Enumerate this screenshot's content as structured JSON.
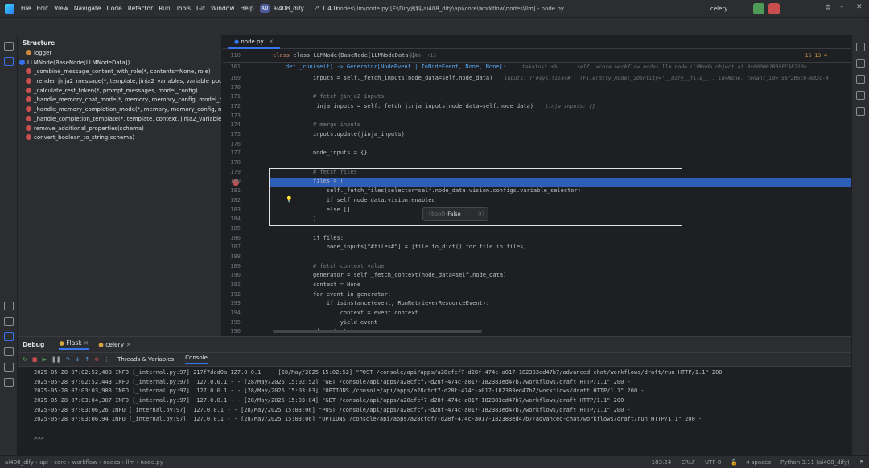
{
  "titlebar": {
    "menu": [
      "File",
      "Edit",
      "View",
      "Navigate",
      "Code",
      "Refactor",
      "Run",
      "Tools",
      "Git",
      "Window",
      "Help"
    ],
    "project_badge": "AD",
    "project_name": "ai408_dify",
    "version": "1.4.0",
    "file_path": "nodes\\llm\\node.py [F:\\Dify资料\\ai408_dify\\api\\core\\workflow\\nodes\\llm] - node.py",
    "run_config": "celery"
  },
  "structure": {
    "title": "Structure",
    "items": [
      {
        "label": "logger",
        "kind": "var",
        "indent": 1
      },
      {
        "label": "LLMNode(BaseNode[LLMNodeData])",
        "kind": "cls",
        "indent": 0
      },
      {
        "label": "_combine_message_content_with_role(*, contents=None, role)",
        "kind": "fn",
        "indent": 1
      },
      {
        "label": "_render_jinja2_message(*, template, jinja2_variables, variable_pool)",
        "kind": "fn",
        "indent": 1
      },
      {
        "label": "_calculate_rest_token(*, prompt_messages, model_config)",
        "kind": "fn",
        "indent": 1
      },
      {
        "label": "_handle_memory_chat_mode(*, memory, memory_config, model_config)",
        "kind": "fn",
        "indent": 1
      },
      {
        "label": "_handle_memory_completion_mode(*, memory, memory_config, model_config)",
        "kind": "fn",
        "indent": 1
      },
      {
        "label": "_handle_completion_template(*, template, context, jinja2_variables, variable_pool)",
        "kind": "fn",
        "indent": 1
      },
      {
        "label": "remove_additional_properties(schema)",
        "kind": "fn",
        "indent": 1
      },
      {
        "label": "convert_boolean_to_string(schema)",
        "kind": "fn",
        "indent": 1
      }
    ]
  },
  "editor": {
    "tab": "node.py",
    "class_line_no": "110",
    "class_line": "class LLMNode(BaseNode[LLMNodeData]):",
    "class_hint": "-LAN- +15",
    "run_line_no": "161",
    "run_sig": "def _run(self) -> Generator[NodeEvent | InNodeEvent, None, None]:",
    "run_author": "takatost +9",
    "run_inline": "self: <core.workflow.nodes.llm.node.LLMNode object at 0x000002B35FCAE710>",
    "inspections": "16 13 4",
    "lines": [
      {
        "n": "169",
        "t": "inputs = self._fetch_inputs(node_data=self.node_data)",
        "i": "inputs: {'#sys.files#': [File(dify_model_identity='__dify__file__', id=None, tenant_id='56f205c6-6d2c-4"
      },
      {
        "n": "170",
        "t": "",
        "i": ""
      },
      {
        "n": "171",
        "t": "# fetch jinja2 inputs",
        "i": ""
      },
      {
        "n": "172",
        "t": "jinja_inputs = self._fetch_jinja_inputs(node_data=self.node_data)",
        "i": "jinja_inputs: {}"
      },
      {
        "n": "173",
        "t": "",
        "i": ""
      },
      {
        "n": "174",
        "t": "# merge inputs",
        "i": ""
      },
      {
        "n": "175",
        "t": "inputs.update(jinja_inputs)",
        "i": ""
      },
      {
        "n": "176",
        "t": "",
        "i": ""
      },
      {
        "n": "177",
        "t": "node_inputs = {}",
        "i": ""
      },
      {
        "n": "178",
        "t": "",
        "i": ""
      },
      {
        "n": "179",
        "t": "# fetch files",
        "i": ""
      },
      {
        "n": "180",
        "t": "files = (",
        "i": ""
      },
      {
        "n": "181",
        "t": "    self._fetch_files(selector=self.node_data.vision.configs.variable_selector)",
        "i": ""
      },
      {
        "n": "182",
        "t": "    if self.node_data.vision.enabled",
        "i": ""
      },
      {
        "n": "183",
        "t": "    else []",
        "i": ""
      },
      {
        "n": "184",
        "t": ")",
        "i": ""
      },
      {
        "n": "185",
        "t": "",
        "i": ""
      },
      {
        "n": "186",
        "t": "if files:",
        "i": ""
      },
      {
        "n": "187",
        "t": "    node_inputs[\"#files#\"] = [file.to_dict() for file in files]",
        "i": ""
      },
      {
        "n": "188",
        "t": "",
        "i": ""
      },
      {
        "n": "189",
        "t": "# fetch context value",
        "i": ""
      },
      {
        "n": "190",
        "t": "generator = self._fetch_context(node_data=self.node_data)",
        "i": ""
      },
      {
        "n": "191",
        "t": "context = None",
        "i": ""
      },
      {
        "n": "192",
        "t": "for event in generator:",
        "i": ""
      },
      {
        "n": "193",
        "t": "    if isinstance(event, RunRetrieverResourceEvent):",
        "i": ""
      },
      {
        "n": "194",
        "t": "        context = event.context",
        "i": ""
      },
      {
        "n": "195",
        "t": "        yield event",
        "i": ""
      },
      {
        "n": "196",
        "t": "if context:",
        "i": ""
      }
    ],
    "popup": {
      "type": "{bool}",
      "value": "False"
    }
  },
  "debug": {
    "title": "Debug",
    "tabs": [
      "Flask",
      "celery"
    ],
    "sub_tabs": [
      "Threads & Variables",
      "Console"
    ],
    "logs": [
      "2025-05-28 07:02:52,403 INFO [_internal.py:97] 217f7dad0a 127.0.0.1 - - [28/May/2025 15:02:52] \"POST /console/api/apps/a28cfcf7-d28f-474c-a017-182383ed47b7/advanced-chat/workflows/draft/run HTTP/1.1\" 200 -",
      "2025-05-28 07:02:52,443 INFO [_internal.py:97]  127.0.0.1 - - [28/May/2025 15:02:52] \"GET /console/api/apps/a28cfcf7-d28f-474c-a017-182383ed47b7/workflows/draft HTTP/1.1\" 200 -",
      "2025-05-28 07:03:03,983 INFO [_internal.py:97]  127.0.0.1 - - [28/May/2025 15:03:03] \"OPTIONS /console/api/apps/a28cfcf7-d28f-474c-a017-182383ed47b7/workflows/draft HTTP/1.1\" 200 -",
      "2025-05-28 07:03:04,307 INFO [_internal.py:97]  127.0.0.1 - - [28/May/2025 15:03:04] \"GET /console/api/apps/a28cfcf7-d28f-474c-a017-182383ed47b7/workflows/draft HTTP/1.1\" 200 -",
      "2025-05-28 07:03:06,26 INFO [_internal.py:97]  127.0.0.1 - - [28/May/2025 15:03:06] \"POST /console/api/apps/a28cfcf7-d28f-474c-a017-182383ed47b7/workflows/draft HTTP/1.1\" 200 -",
      "2025-05-28 07:03:06,94 INFO [_internal.py:97]  127.0.0.1 - - [28/May/2025 15:03:06] \"OPTIONS /console/api/apps/a28cfcf7-d28f-474c-a017-182383ed47b7/advanced-chat/workflows/draft/run HTTP/1.1\" 200 -"
    ],
    "prompt": ">>>"
  },
  "status": {
    "breadcrumb": [
      "ai408_dify",
      "api",
      "core",
      "workflow",
      "nodes",
      "llm",
      "node.py"
    ],
    "position": "183:24",
    "line_sep": "CRLF",
    "encoding": "UTF-8",
    "indent": "4 spaces",
    "interpreter": "Python 3.11 (ai408_dify)"
  },
  "colors": {
    "accent": "#3574f0",
    "breakpoint": "#c94f4f",
    "highlight": "#2d5fb8",
    "run_green": "#4e9a57",
    "stop_red": "#c94f4f"
  }
}
